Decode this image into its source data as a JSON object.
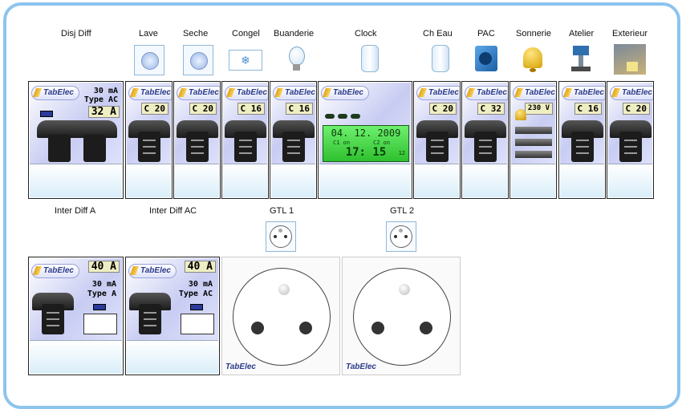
{
  "top_labels": [
    "Disj Diff",
    "Lave",
    "Seche",
    "Congel",
    "Buanderie",
    "Clock",
    "Ch Eau",
    "PAC",
    "Sonnerie",
    "Atelier",
    "Exterieur"
  ],
  "middle_labels": [
    "Inter Diff A",
    "Inter Diff AC",
    "GTL 1",
    "GTL 2"
  ],
  "brand": "TabElec",
  "disj_diff": {
    "sensitivity": "30 mA",
    "type": "Type  AC",
    "rating": "32 A"
  },
  "breakers": [
    {
      "key": "lave",
      "rating": "C 20"
    },
    {
      "key": "seche",
      "rating": "C 20"
    },
    {
      "key": "congel",
      "rating": "C 16"
    },
    {
      "key": "buanderie",
      "rating": "C 16"
    },
    {
      "key": "ch_eau",
      "rating": "C 20"
    },
    {
      "key": "pac",
      "rating": "C 32"
    },
    {
      "key": "sonnerie",
      "rating": "230 V"
    },
    {
      "key": "atelier",
      "rating": "C 16"
    },
    {
      "key": "exterieur",
      "rating": "C 20"
    }
  ],
  "clock": {
    "date": "04. 12. 2009",
    "label_left": "C1 on",
    "label_right": "C2 on",
    "time": "17: 15",
    "suffix": "12"
  },
  "inter_a": {
    "rating": "40 A",
    "sensitivity": "30 mA",
    "type": "Type A"
  },
  "inter_ac": {
    "rating": "40 A",
    "sensitivity": "30 mA",
    "type": "Type AC"
  },
  "colors": {
    "frame": "#8cc4ee",
    "lcd": "#3ee03e",
    "panel": "#c8ccf2"
  }
}
